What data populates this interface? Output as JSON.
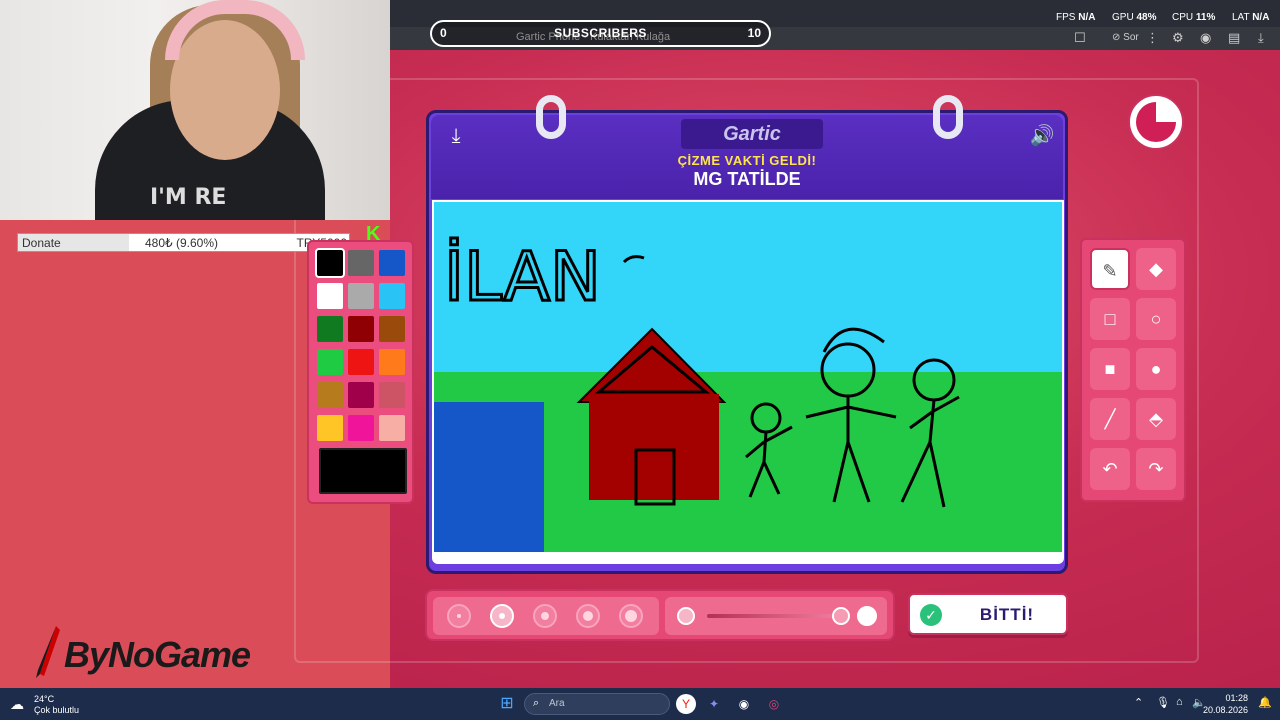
{
  "browser": {
    "tab_title": "Gartic Phone - Kulaktan Kulağa",
    "tab_action": "Sor"
  },
  "overlay": {
    "subscribers_label": "SUBSCRIBERS",
    "subscribers_current": "0",
    "subscribers_goal": "10",
    "stats": {
      "fps_label": "FPS",
      "fps_value": "N/A",
      "gpu_label": "GPU",
      "gpu_value": "48%",
      "cpu_label": "CPU",
      "cpu_value": "11%",
      "lat_label": "LAT",
      "lat_value": "N/A"
    },
    "donate": {
      "label": "Donate",
      "progress_text": "480₺ (9.60%)",
      "progress_fraction": 0.096,
      "goal": "TRY5000"
    },
    "watermark": "ByNoGame",
    "webcam_shirt_text": "I'M RE"
  },
  "game": {
    "logo": "Gartic",
    "instruction": "ÇİZME VAKTİ GELDİ!",
    "prompt": "MG TATİLDE",
    "timer_remaining_fraction": 0.75,
    "done_label": "BİTTİ!",
    "palette": {
      "colors": [
        "#000000",
        "#666666",
        "#1556c8",
        "#ffffff",
        "#aaaaaa",
        "#29c4f5",
        "#0f7a1f",
        "#8e0004",
        "#9a4b0c",
        "#1fcb43",
        "#ef1414",
        "#ff7a1a",
        "#b57b1d",
        "#a0004a",
        "#cc5464",
        "#ffc526",
        "#f0149a",
        "#f7aea5"
      ],
      "selected_index": 0,
      "current_color": "#000000"
    },
    "brush_sizes": [
      1,
      2,
      3,
      4,
      5
    ],
    "selected_brush_index": 1,
    "opacity_fraction": 1.0,
    "canvas_text": "İLAN"
  },
  "taskbar": {
    "weather_temp": "24°C",
    "weather_desc": "Çok bulutlu",
    "search_placeholder": "Ara",
    "time": "01:28",
    "date": "20.08.2026"
  }
}
